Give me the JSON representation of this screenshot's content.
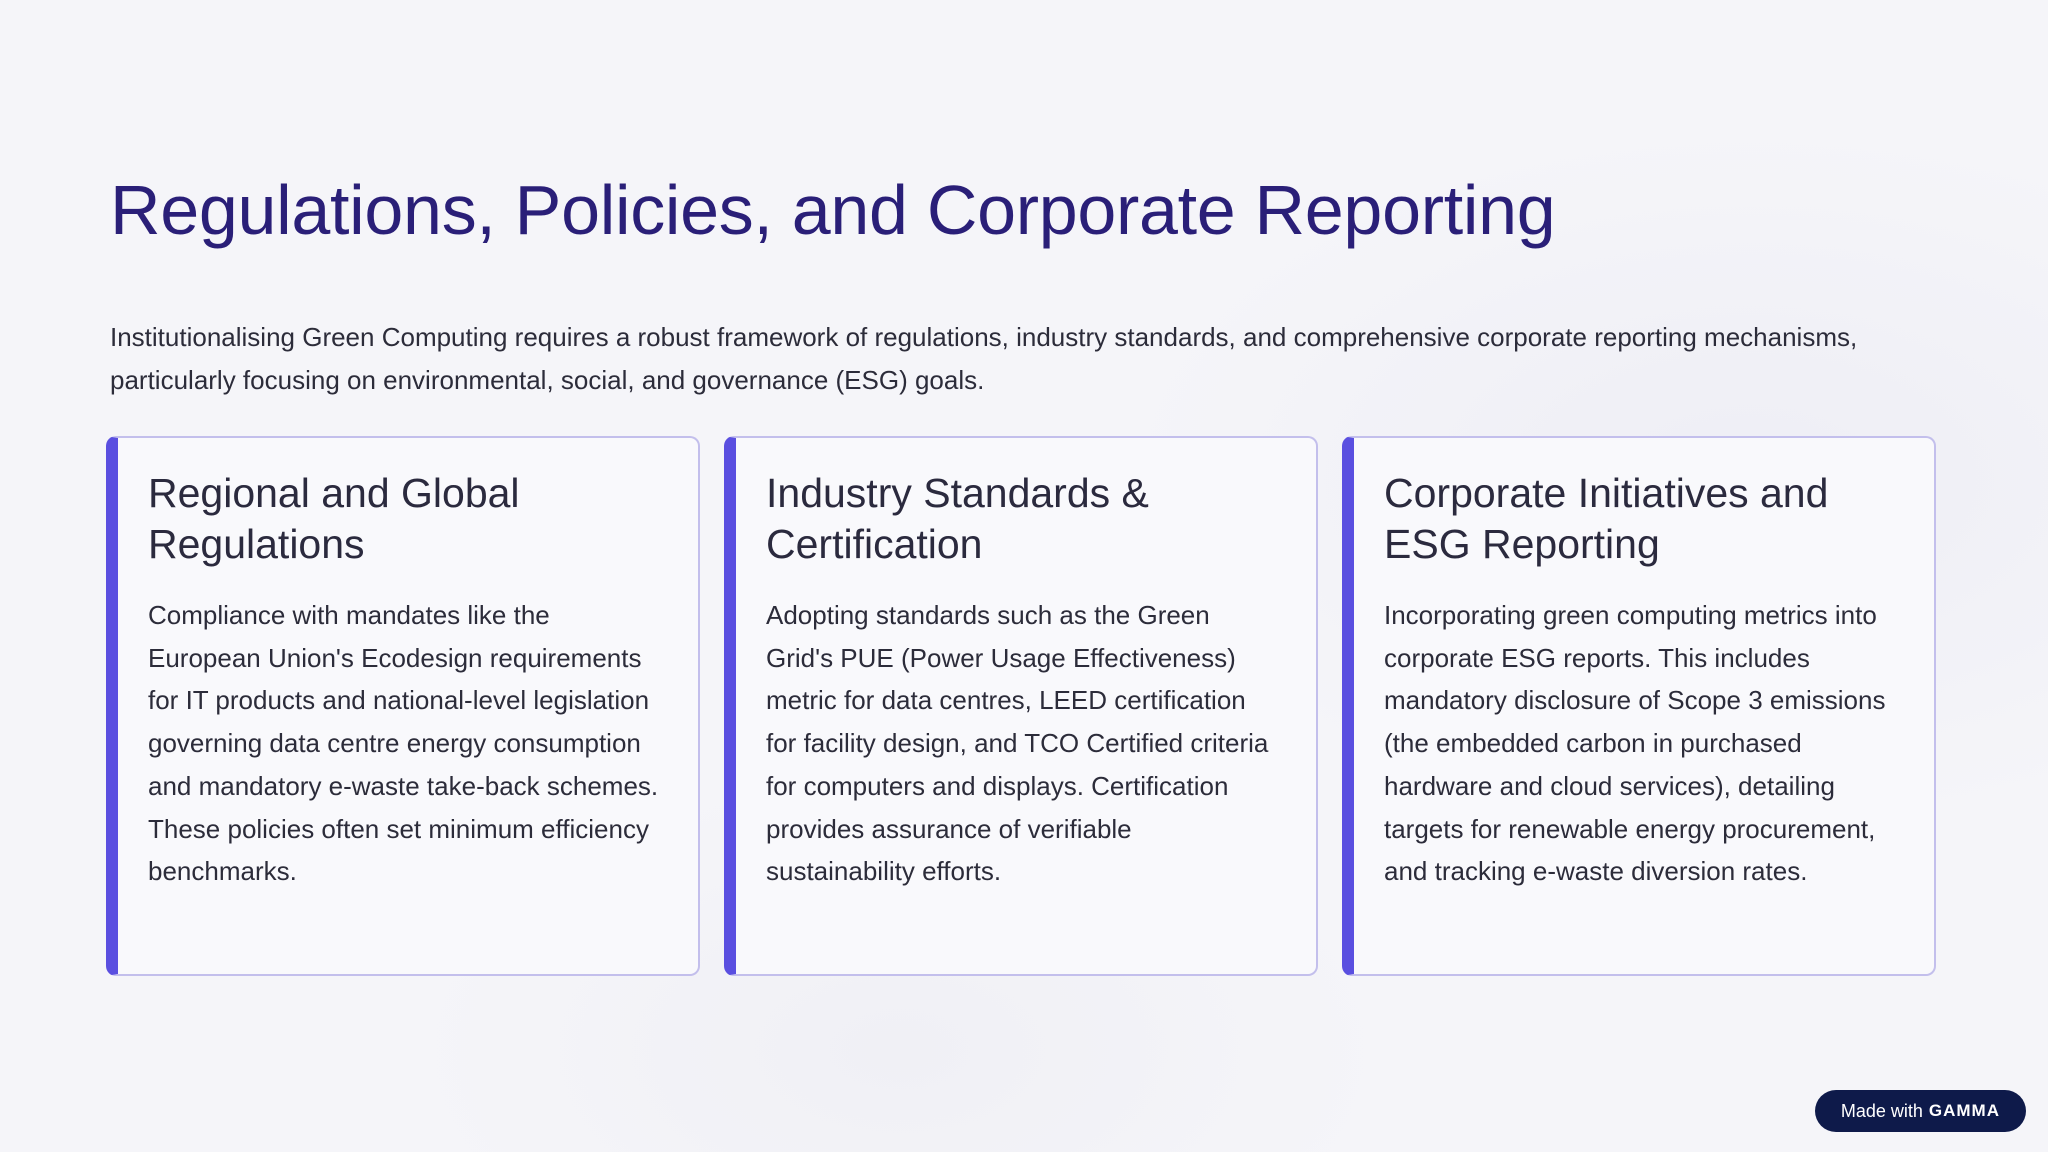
{
  "slide": {
    "title": "Regulations, Policies, and Corporate Reporting",
    "intro": "Institutionalising Green Computing requires a robust framework of regulations, industry standards, and comprehensive corporate reporting mechanisms, particularly focusing on environmental, social, and governance (ESG) goals."
  },
  "cards": [
    {
      "title": "Regional and Global Regulations",
      "body": "Compliance with mandates like the European Union's Ecodesign requirements for IT products and national-level legislation governing data centre energy consumption and mandatory e-waste take-back schemes. These policies often set minimum efficiency benchmarks."
    },
    {
      "title": "Industry Standards & Certification",
      "body": "Adopting standards such as the Green Grid's PUE (Power Usage Effectiveness) metric for data centres, LEED certification for facility design, and TCO Certified criteria for computers and displays. Certification provides assurance of verifiable sustainability efforts."
    },
    {
      "title": "Corporate Initiatives and ESG Reporting",
      "body": "Incorporating green computing metrics into corporate ESG reports. This includes mandatory disclosure of Scope 3 emissions (the embedded carbon in purchased hardware and cloud services), detailing targets for renewable energy procurement, and tracking e-waste diversion rates."
    }
  ],
  "badge": {
    "prefix": "Made with",
    "logo": "GAMMA"
  },
  "colors": {
    "title": "#2a1f78",
    "accent_bar": "#5a4fe0",
    "card_border": "#c3bfec",
    "badge_bg": "#0e1a4a"
  }
}
